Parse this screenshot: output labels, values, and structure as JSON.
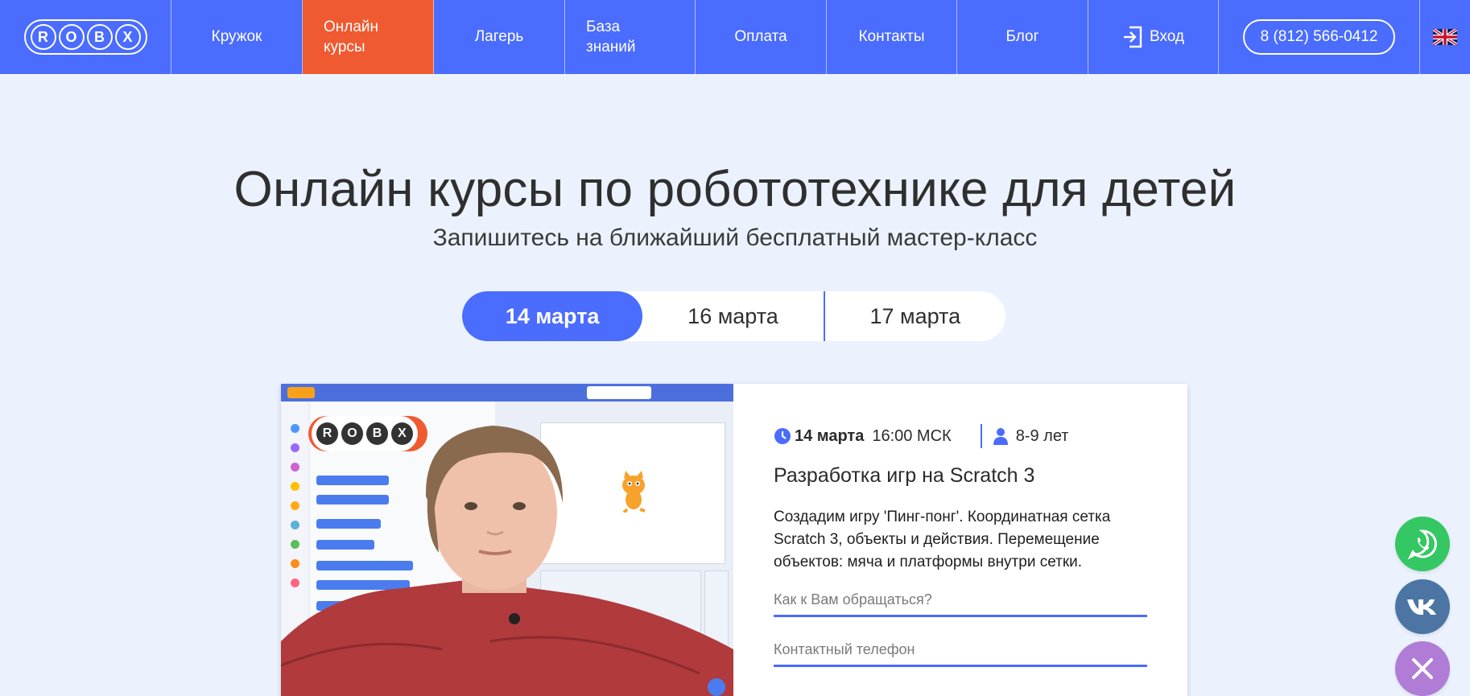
{
  "logo": {
    "letters": [
      "R",
      "O",
      "B",
      "X"
    ]
  },
  "nav": {
    "items": [
      {
        "label": "Кружок"
      },
      {
        "label": "Онлайн\nкурсы"
      },
      {
        "label": "Лагерь"
      },
      {
        "label": "База\nзнаний"
      },
      {
        "label": "Оплата"
      },
      {
        "label": "Контакты"
      },
      {
        "label": "Блог"
      }
    ],
    "login_label": "Вход",
    "phone": "8 (812) 566-0412",
    "language_flag": "uk-flag-icon"
  },
  "hero": {
    "title": "Онлайн курсы по робототехнике для детей",
    "subtitle": "Запишитесь на ближайший бесплатный мастер-класс"
  },
  "date_tabs": [
    {
      "label": "14 марта",
      "active": true
    },
    {
      "label": "16 марта",
      "active": false
    },
    {
      "label": "17 марта",
      "active": false
    }
  ],
  "course": {
    "date": "14 марта",
    "time": "16:00 МСК",
    "age": "8-9 лет",
    "title": "Разработка игр на Scratch 3",
    "description": "Создадим игру 'Пинг-понг'. Координатная сетка Scratch 3, объекты и действия. Перемещение объектов: мяча и платформы внутри сетки.",
    "name_placeholder": "Как к Вам обращаться?",
    "phone_placeholder": "Контактный телефон"
  },
  "colors": {
    "nav_blue": "#4a6cff",
    "active_orange": "#f05a30",
    "page_bg": "#ebf2fe",
    "whatsapp": "#35c763",
    "vk": "#4c75a3",
    "close": "#b07cd6"
  },
  "floating": {
    "icons": [
      "whatsapp-icon",
      "vk-icon",
      "close-icon"
    ]
  }
}
